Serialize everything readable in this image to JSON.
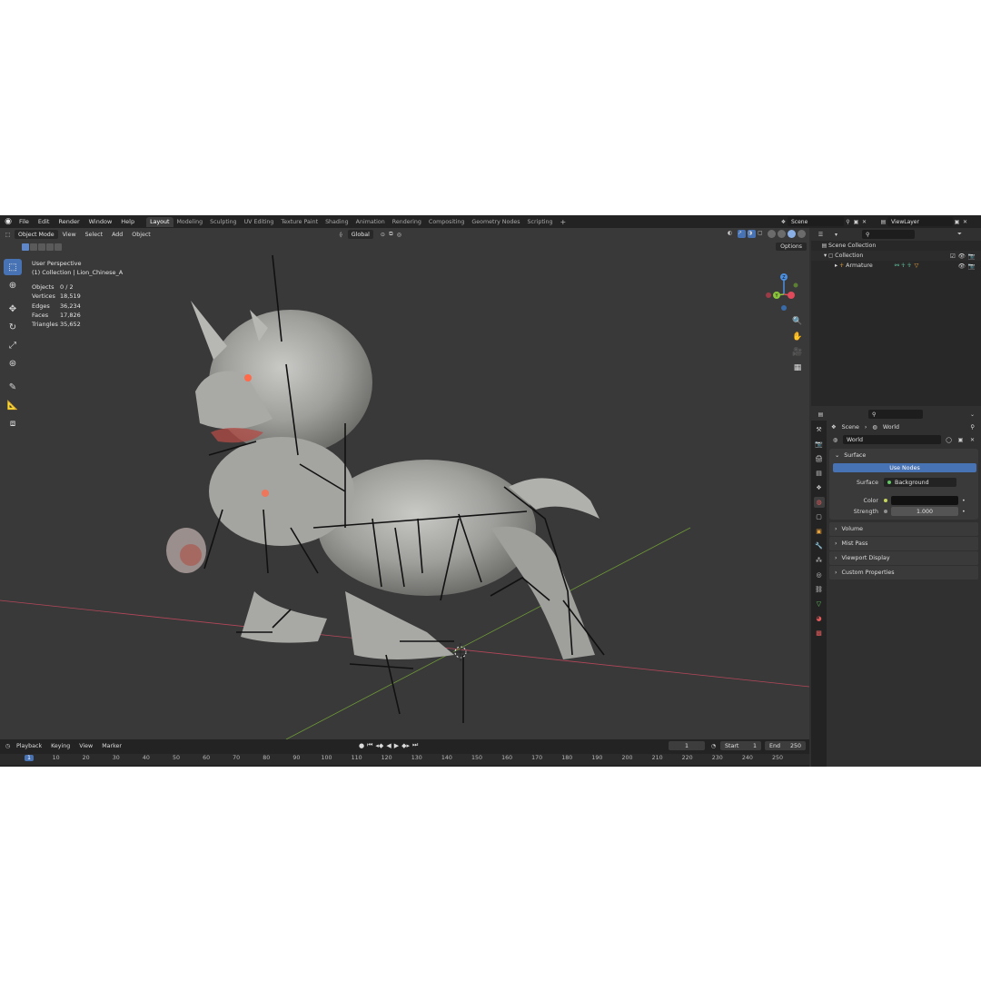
{
  "menu": [
    "File",
    "Edit",
    "Render",
    "Window",
    "Help"
  ],
  "workspaces": [
    {
      "label": "Layout",
      "active": true
    },
    {
      "label": "Modeling"
    },
    {
      "label": "Sculpting"
    },
    {
      "label": "UV Editing"
    },
    {
      "label": "Texture Paint"
    },
    {
      "label": "Shading"
    },
    {
      "label": "Animation"
    },
    {
      "label": "Rendering"
    },
    {
      "label": "Compositing"
    },
    {
      "label": "Geometry Nodes"
    },
    {
      "label": "Scripting"
    }
  ],
  "scene_name": "Scene",
  "view_layer": "ViewLayer",
  "viewport": {
    "mode": "Object Mode",
    "menus": [
      "View",
      "Select",
      "Add",
      "Object"
    ],
    "orientation": "Global",
    "options_label": "Options",
    "perspective": "User Perspective",
    "collection_info": "(1) Collection | Lion_Chinese_A",
    "stats": [
      {
        "label": "Objects",
        "value": "0 / 2"
      },
      {
        "label": "Vertices",
        "value": "18,519"
      },
      {
        "label": "Edges",
        "value": "36,234"
      },
      {
        "label": "Faces",
        "value": "17,826"
      },
      {
        "label": "Triangles",
        "value": "35,652"
      }
    ]
  },
  "timeline": {
    "menus": [
      "Playback",
      "Keying",
      "View",
      "Marker"
    ],
    "current_frame": "1",
    "start_label": "Start",
    "start": "1",
    "end_label": "End",
    "end": "250",
    "ticks": [
      "1",
      "10",
      "20",
      "30",
      "40",
      "50",
      "60",
      "70",
      "80",
      "90",
      "100",
      "110",
      "120",
      "130",
      "140",
      "150",
      "160",
      "170",
      "180",
      "190",
      "200",
      "210",
      "220",
      "230",
      "240",
      "250"
    ]
  },
  "outliner": {
    "items": [
      {
        "label": "Scene Collection"
      },
      {
        "label": "Collection"
      },
      {
        "label": "Armature"
      }
    ]
  },
  "properties": {
    "breadcrumb": [
      "Scene",
      "World"
    ],
    "world_name": "World",
    "surface_panel": "Surface",
    "use_nodes": "Use Nodes",
    "surface_label": "Surface",
    "surface_value": "Background",
    "color_label": "Color",
    "strength_label": "Strength",
    "strength_value": "1.000",
    "subpanels": [
      "Volume",
      "Mist Pass",
      "Viewport Display",
      "Custom Properties"
    ]
  },
  "colors": {
    "accent": "#4772b3",
    "x_axis": "#e04a5b",
    "y_axis": "#8ac53b",
    "z_axis": "#4c8fe0"
  }
}
